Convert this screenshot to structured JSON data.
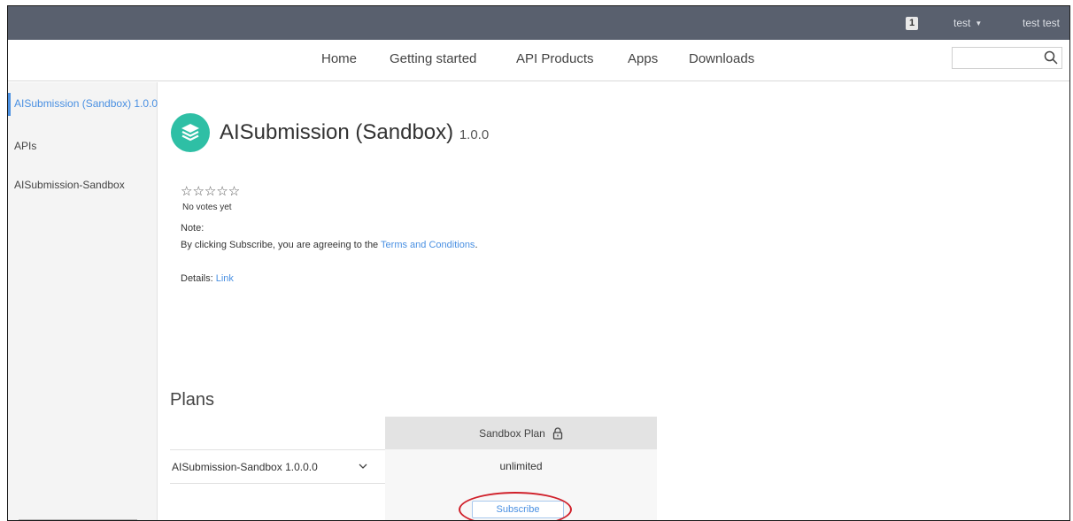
{
  "topbar": {
    "notification_count": "1",
    "user_menu_label": "test",
    "user_full_name": "test test"
  },
  "nav": {
    "items": [
      "Home",
      "Getting started",
      "API Products",
      "Apps",
      "Downloads"
    ],
    "search_placeholder": ""
  },
  "sidebar": {
    "items": [
      {
        "label": "AISubmission (Sandbox) 1.0.0",
        "active": true
      },
      {
        "label": "APIs"
      },
      {
        "label": "AISubmission-Sandbox"
      }
    ]
  },
  "product": {
    "title": "AISubmission (Sandbox)",
    "version": "1.0.0",
    "rating_stars": "☆☆☆☆☆",
    "votes_text": "No votes yet",
    "note_label": "Note:",
    "note_text_before": "By clicking Subscribe, you are agreeing to the ",
    "note_link": "Terms and Conditions",
    "note_text_after": ".",
    "details_label": "Details: ",
    "details_link": "Link"
  },
  "plans": {
    "title": "Plans",
    "plan_name": "Sandbox Plan",
    "api_row": "AISubmission-Sandbox 1.0.0.0",
    "plan_value": "unlimited",
    "subscribe_label": "Subscribe"
  },
  "colors": {
    "topbar": "#59606e",
    "accent": "#4a90e2",
    "product_icon": "#2ebfa5",
    "highlight": "#d0202a"
  }
}
